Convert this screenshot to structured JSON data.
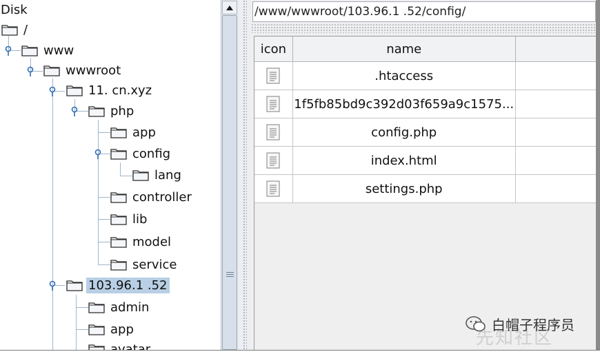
{
  "tree": {
    "root_label": "Disk",
    "nodes": [
      {
        "label": "/"
      },
      {
        "label": "www"
      },
      {
        "label": "wwwroot"
      },
      {
        "label": "11.       cn.xyz"
      },
      {
        "label": "php"
      },
      {
        "label": "app"
      },
      {
        "label": "config"
      },
      {
        "label": "lang"
      },
      {
        "label": "controller"
      },
      {
        "label": "lib"
      },
      {
        "label": "model"
      },
      {
        "label": "service"
      },
      {
        "label": "103.96.1    .52"
      },
      {
        "label": "admin"
      },
      {
        "label": "app"
      },
      {
        "label": "avatar"
      }
    ]
  },
  "path_bar": {
    "value": "/www/wwwroot/103.96.1    .52/config/"
  },
  "file_table": {
    "headers": [
      "icon",
      "name",
      ""
    ],
    "rows": [
      {
        "name": ".htaccess",
        "icon": "file-icon"
      },
      {
        "name": "1f5fb85bd9c392d03f659a9c1575...",
        "icon": "file-icon"
      },
      {
        "name": "config.php",
        "icon": "file-icon"
      },
      {
        "name": "index.html",
        "icon": "file-icon"
      },
      {
        "name": "settings.php",
        "icon": "file-icon"
      }
    ]
  },
  "watermark": {
    "text": "白帽子程序员",
    "faint_text": "先知社区"
  },
  "colors": {
    "selection": "#b8cfe5",
    "tree_line": "#9fb5cc",
    "table_header": "#f1f2f4"
  }
}
